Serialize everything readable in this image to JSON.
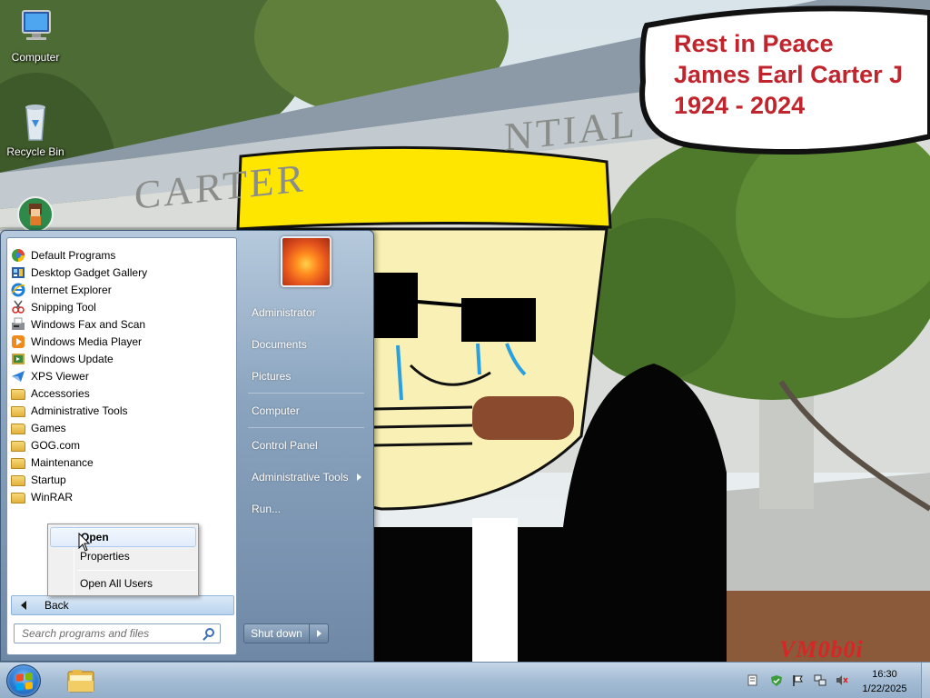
{
  "desktop": {
    "icons": [
      {
        "label": "Computer"
      },
      {
        "label": "Recycle Bin"
      }
    ],
    "wallpaper_caption": {
      "line1": "Rest in Peace",
      "line2": "James Earl Carter J",
      "line3": "1924 - 2024"
    },
    "building_sign": "CARTER",
    "building_sign_right": "NTIAL",
    "watermark": "VM0b0i"
  },
  "start_menu": {
    "programs": [
      {
        "label": "Default Programs",
        "icon": "default-programs-icon"
      },
      {
        "label": "Desktop Gadget Gallery",
        "icon": "gadget-gallery-icon"
      },
      {
        "label": "Internet Explorer",
        "icon": "internet-explorer-icon"
      },
      {
        "label": "Snipping Tool",
        "icon": "snipping-tool-icon"
      },
      {
        "label": "Windows Fax and Scan",
        "icon": "fax-scan-icon"
      },
      {
        "label": "Windows Media Player",
        "icon": "media-player-icon"
      },
      {
        "label": "Windows Update",
        "icon": "windows-update-icon"
      },
      {
        "label": "XPS Viewer",
        "icon": "xps-viewer-icon"
      },
      {
        "label": "Accessories",
        "icon": "folder-icon"
      },
      {
        "label": "Administrative Tools",
        "icon": "folder-icon"
      },
      {
        "label": "Games",
        "icon": "folder-icon"
      },
      {
        "label": "GOG.com",
        "icon": "folder-icon"
      },
      {
        "label": "Maintenance",
        "icon": "folder-icon"
      },
      {
        "label": "Startup",
        "icon": "folder-icon"
      },
      {
        "label": "WinRAR",
        "icon": "folder-icon"
      }
    ],
    "back_label": "Back",
    "search_placeholder": "Search programs and files",
    "right_items": [
      {
        "label": "Administrator"
      },
      {
        "label": "Documents"
      },
      {
        "label": "Pictures"
      },
      {
        "label": "Computer"
      },
      {
        "label": "Control Panel"
      },
      {
        "label": "Administrative Tools"
      },
      {
        "label": "Run..."
      }
    ],
    "shutdown_label": "Shut down"
  },
  "context_menu": {
    "items": [
      {
        "label": "Open",
        "highlighted": true
      },
      {
        "label": "Properties",
        "highlighted": false
      },
      {
        "label": "Open All Users",
        "highlighted": false
      }
    ]
  },
  "taskbar": {
    "clock_time": "16:30",
    "clock_date": "1/22/2025"
  }
}
